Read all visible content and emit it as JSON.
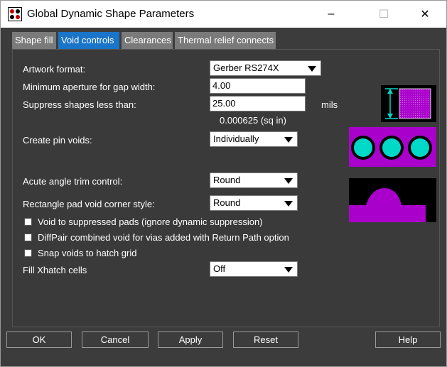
{
  "window": {
    "title": "Global Dynamic Shape Parameters",
    "app_icon": "shape-parameters-icon",
    "controls": {
      "minimize": "–",
      "maximize": "☐",
      "close": "✕"
    }
  },
  "tabs": [
    {
      "label": "Shape fill",
      "active": false
    },
    {
      "label": "Void controls",
      "active": true
    },
    {
      "label": "Clearances",
      "active": false
    },
    {
      "label": "Thermal relief connects",
      "active": false
    }
  ],
  "form": {
    "artwork_format": {
      "label": "Artwork format:",
      "value": "Gerber RS274X"
    },
    "min_aperture": {
      "label": "Minimum aperture for gap width:",
      "value": "4.00"
    },
    "suppress": {
      "label": "Suppress shapes less than:",
      "value": "25.00",
      "unit": "mils",
      "area": "0.000625 (sq in)"
    },
    "pin_voids": {
      "label": "Create pin voids:",
      "value": "Individually"
    },
    "acute_angle": {
      "label": "Acute angle trim control:",
      "value": "Round"
    },
    "rect_corner": {
      "label": "Rectangle pad void corner style:",
      "value": "Round"
    },
    "checkboxes": [
      {
        "label": "Void to suppressed pads (ignore dynamic suppression)",
        "checked": false
      },
      {
        "label": "DiffPair combined void for vias added with Return Path option",
        "checked": false
      },
      {
        "label": "Snap voids to hatch grid",
        "checked": false
      }
    ],
    "fill_xhatch": {
      "label": "Fill Xhatch cells",
      "value": "Off"
    }
  },
  "buttons": {
    "ok": "OK",
    "cancel": "Cancel",
    "apply": "Apply",
    "reset": "Reset",
    "help": "Help"
  },
  "colors": {
    "accent": "#1a74c8",
    "shape": "#aa00cc",
    "pad": "#00d8c8",
    "preview_bg": "#000000",
    "panel_bg": "#3a3a3a"
  }
}
